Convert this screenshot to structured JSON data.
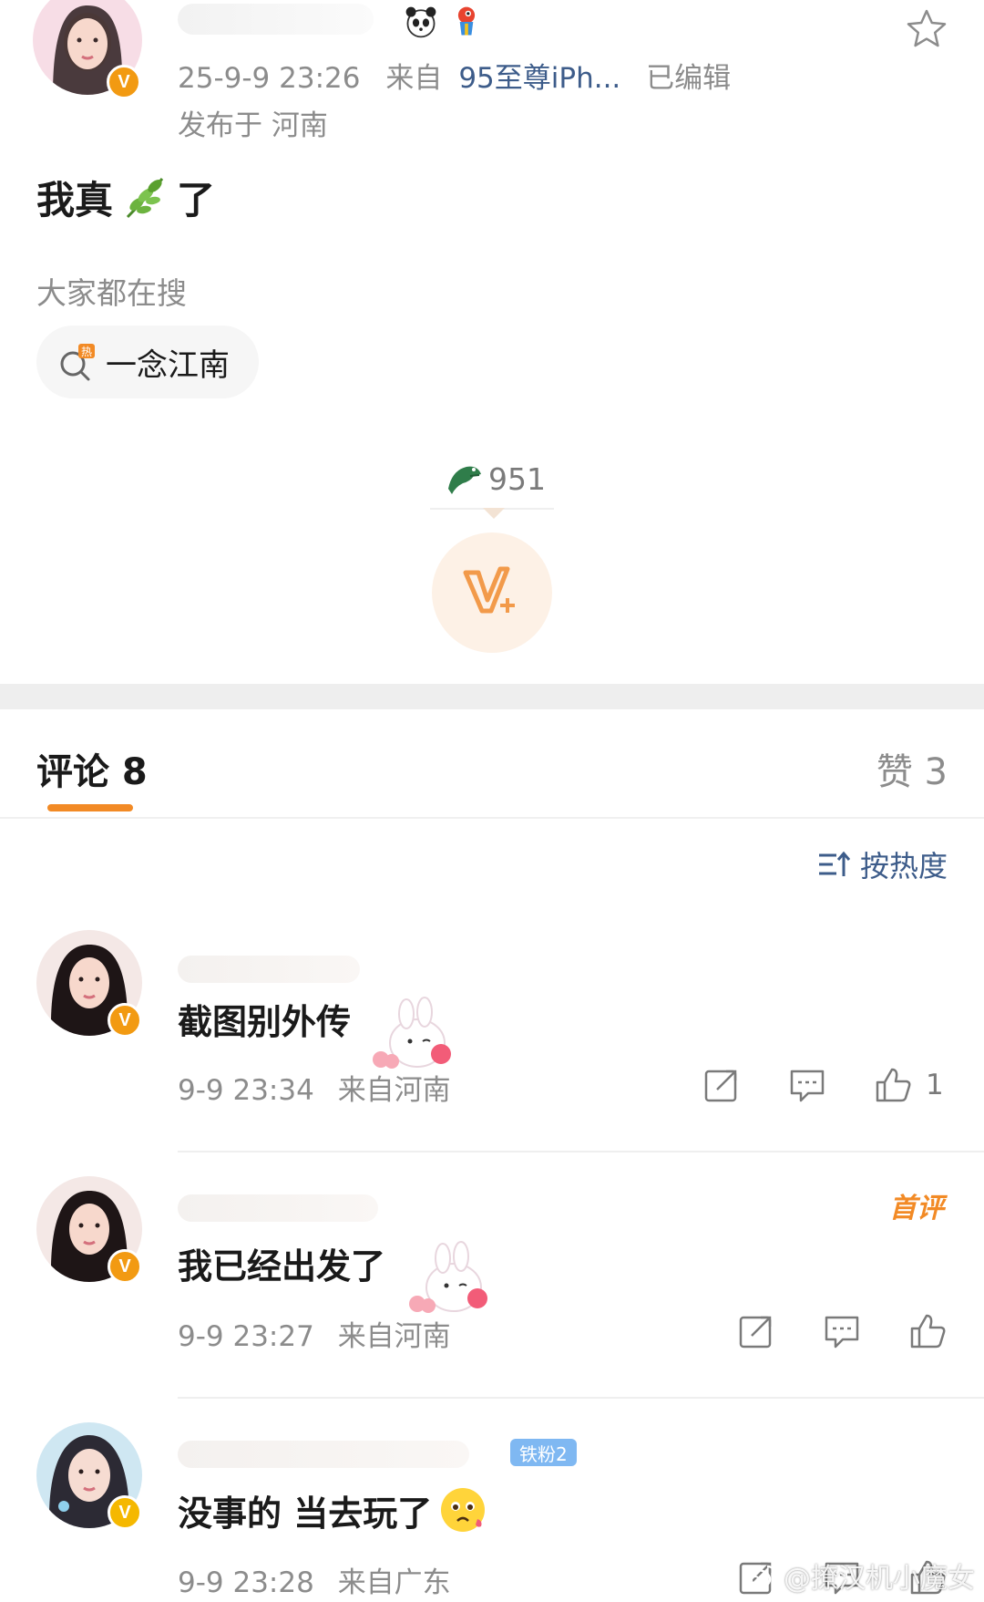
{
  "post": {
    "timestamp": "25-9-9 23:26",
    "source_prefix": "来自",
    "source_device": "95至尊iPh...",
    "edited": "已编辑",
    "location": "发布于 河南",
    "text_before": "我真",
    "text_after": "了",
    "leaf_emoji": "🌿",
    "badges": [
      "panda-icon",
      "parrot-icon"
    ]
  },
  "search": {
    "title": "大家都在搜",
    "hot_topic": "一念江南"
  },
  "reward": {
    "count": "951"
  },
  "tabs": {
    "comments_label": "评论 8",
    "likes_label": "赞 3"
  },
  "sort": {
    "label": "按热度"
  },
  "comments": [
    {
      "text": "截图别外传",
      "time": "9-9 23:34",
      "location": "来自河南",
      "likes": "1"
    },
    {
      "text": "我已经出发了",
      "time": "9-9 23:27",
      "location": "来自河南",
      "likes": "",
      "badge": "首评"
    },
    {
      "text": "没事的 当去玩了",
      "time": "9-9 23:28",
      "location": "来自广东",
      "likes": "",
      "fan_badge": "铁粉2"
    }
  ],
  "watermark": "@撩汉机小魔女",
  "colors": {
    "accent_orange": "#f28a25",
    "link_blue": "#3d5c8a",
    "muted_gray": "#8c8c8c",
    "verified_badge": "#f29a12"
  }
}
